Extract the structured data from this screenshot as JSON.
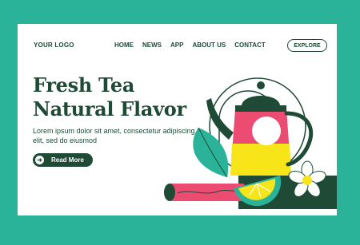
{
  "header": {
    "logo": "YOUR LOGO",
    "nav": [
      "HOME",
      "NEWS",
      "APP",
      "ABOUT US",
      "CONTACT"
    ],
    "explore_label": "EXPLORE"
  },
  "hero": {
    "title_line1": "Fresh Tea",
    "title_line2": "Natural Flavor",
    "body": "Lorem ipsum dolor sit amet, consectetur adipiscing elit, sed do eiusmod",
    "cta_label": "Read More",
    "cta_icon": "arrow-right-icon"
  },
  "colors": {
    "background": "#2bb39a",
    "dark_green": "#1e4a36",
    "leaf_green": "#2bb39a",
    "pink": "#ec4c72",
    "yellow": "#f7e51a",
    "white": "#ffffff"
  }
}
